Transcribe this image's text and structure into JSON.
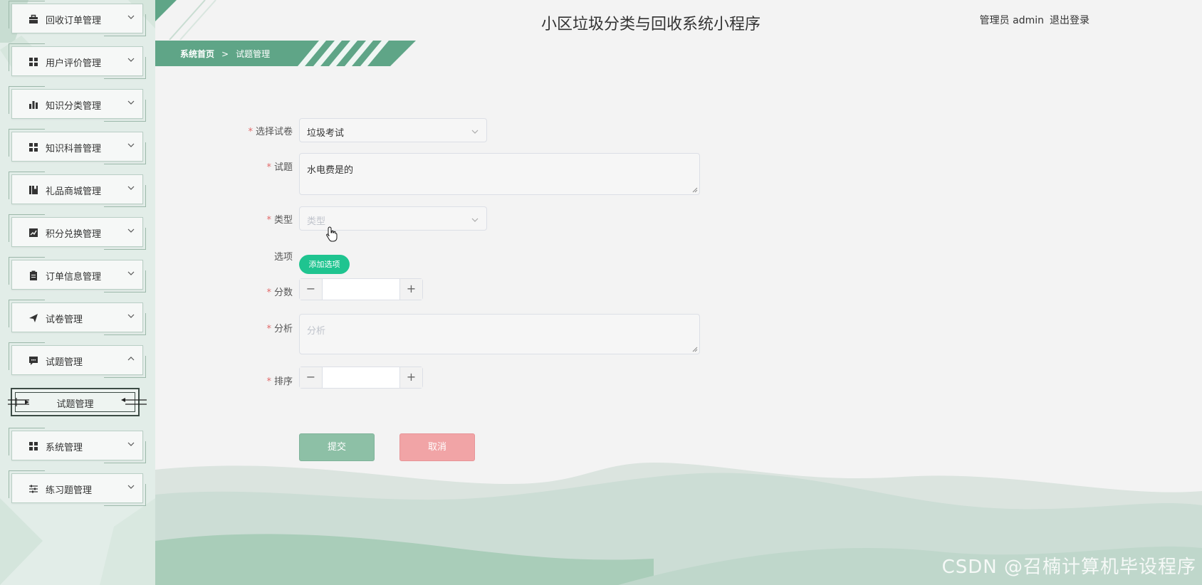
{
  "header": {
    "title": "小区垃圾分类与回收系统小程序",
    "user_text": "管理员 admin",
    "logout": "退出登录"
  },
  "breadcrumb": {
    "home": "系统首页",
    "separator": ">",
    "current": "试题管理"
  },
  "sidebar": {
    "items": [
      {
        "label": "回收订单管理",
        "icon": "briefcase-icon"
      },
      {
        "label": "用户评价管理",
        "icon": "grid-icon"
      },
      {
        "label": "知识分类管理",
        "icon": "bar-chart-icon"
      },
      {
        "label": "知识科普管理",
        "icon": "grid-icon"
      },
      {
        "label": "礼品商城管理",
        "icon": "book-icon"
      },
      {
        "label": "积分兑换管理",
        "icon": "trend-icon"
      },
      {
        "label": "订单信息管理",
        "icon": "clipboard-icon"
      },
      {
        "label": "试卷管理",
        "icon": "send-icon"
      },
      {
        "label": "试题管理",
        "icon": "chat-icon",
        "expanded": true
      },
      {
        "label": "系统管理",
        "icon": "grid-icon"
      },
      {
        "label": "练习题管理",
        "icon": "sliders-icon"
      }
    ],
    "sub_item": "试题管理"
  },
  "form": {
    "paper": {
      "label": "选择试卷",
      "value": "垃圾考试"
    },
    "question": {
      "label": "试题",
      "value": "水电费是的"
    },
    "type": {
      "label": "类型",
      "placeholder": "类型"
    },
    "options": {
      "label": "选项",
      "button": "添加选项"
    },
    "score": {
      "label": "分数",
      "minus": "−",
      "plus": "+"
    },
    "analysis": {
      "label": "分析",
      "placeholder": "分析"
    },
    "sort": {
      "label": "排序",
      "minus": "−",
      "plus": "+"
    },
    "submit": "提交",
    "cancel": "取消"
  },
  "watermark": "CSDN @召楠计算机毕设程序",
  "colors": {
    "accent_green": "#1fc490",
    "breadcrumb_green": "#5fa587",
    "submit": "#8dc0a6",
    "cancel": "#f1a4a6",
    "required": "#e26a6a"
  }
}
